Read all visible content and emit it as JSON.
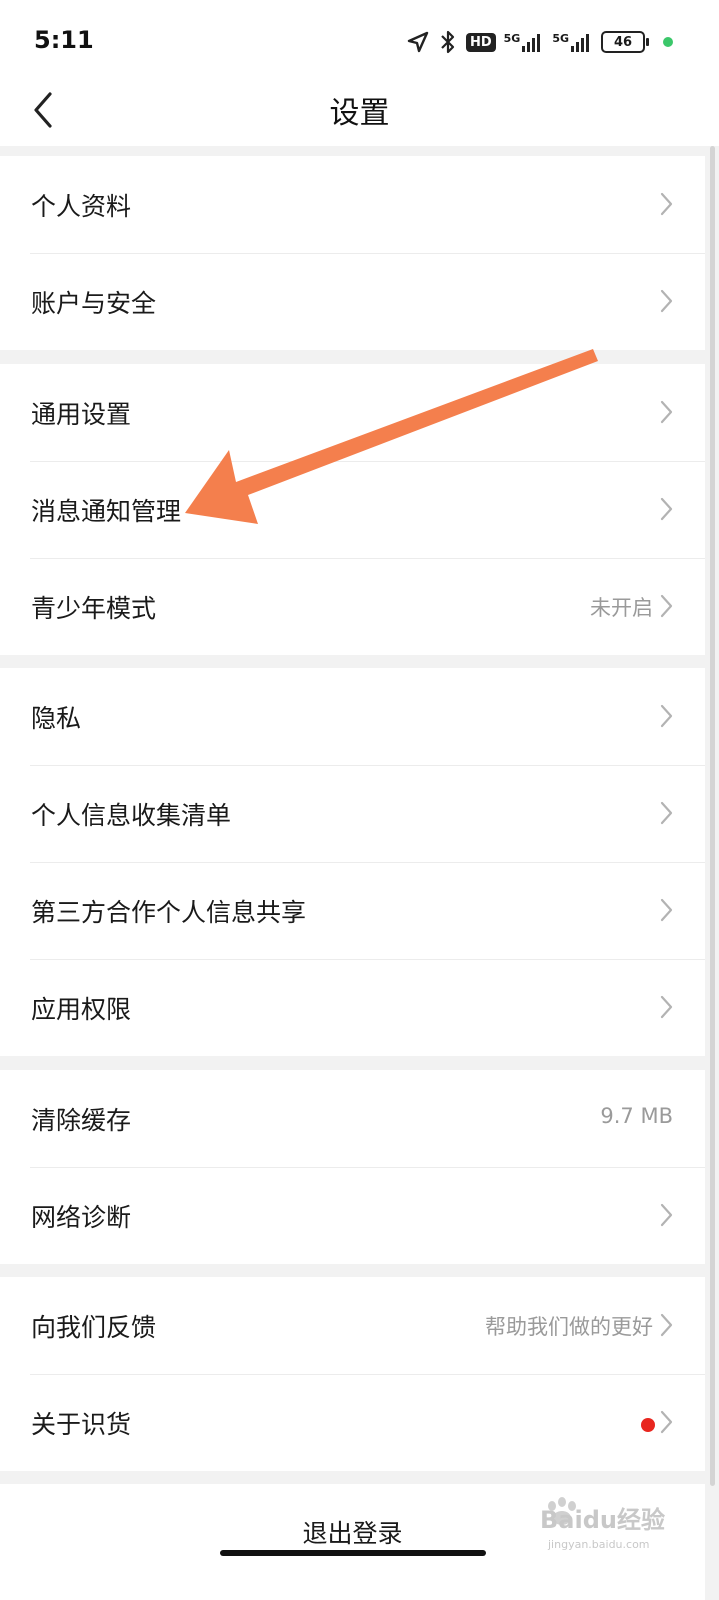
{
  "status_bar": {
    "time": "5:11",
    "hd_label": "HD",
    "signal_1_label": "5G",
    "signal_2_label": "5G",
    "battery_level": "46",
    "battery_percent": 46,
    "dot_color": "#3bc76a"
  },
  "nav": {
    "title": "设置"
  },
  "sections": [
    {
      "items": [
        {
          "label": "个人资料"
        },
        {
          "label": "账户与安全"
        }
      ]
    },
    {
      "items": [
        {
          "label": "通用设置"
        },
        {
          "label": "消息通知管理"
        },
        {
          "label": "青少年模式",
          "value": "未开启"
        }
      ]
    },
    {
      "items": [
        {
          "label": "隐私"
        },
        {
          "label": "个人信息收集清单"
        },
        {
          "label": "第三方合作个人信息共享"
        },
        {
          "label": "应用权限"
        }
      ]
    },
    {
      "items": [
        {
          "label": "清除缓存",
          "value": "9.7 MB"
        },
        {
          "label": "网络诊断"
        }
      ]
    },
    {
      "items": [
        {
          "label": "向我们反馈",
          "value": "帮助我们做的更好"
        },
        {
          "label": "关于识货"
        }
      ]
    }
  ],
  "logout": {
    "label": "退出登录"
  },
  "watermark": {
    "text": "Baidu经验",
    "subtext": "jingyan.baidu.com"
  },
  "colors": {
    "accent_arrow": "#f47f4d",
    "badge_red": "#e8261f",
    "secondary_text": "#9a9a9a",
    "background": "#f2f2f2"
  }
}
